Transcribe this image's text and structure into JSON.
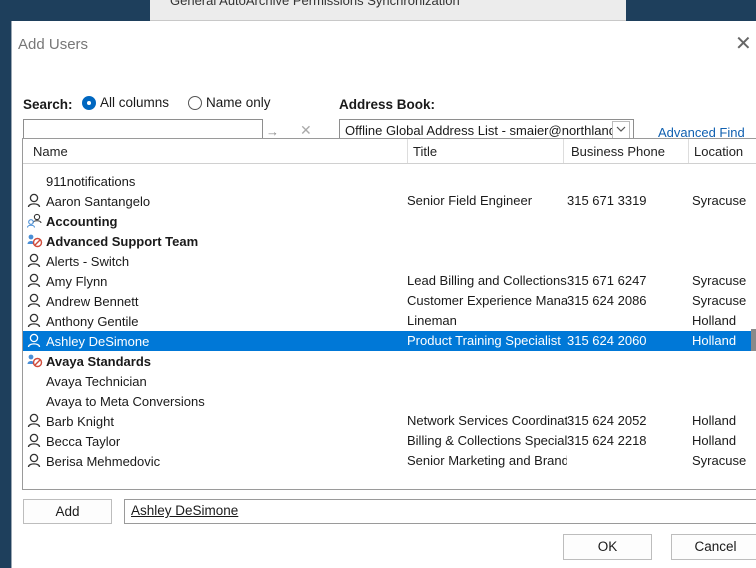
{
  "background_window": {
    "tabs_text": "General  AutoArchive  Permissions  Synchronization"
  },
  "dialog": {
    "title": "Add Users",
    "close_glyph": "✕"
  },
  "search": {
    "label": "Search:",
    "option_all": "All columns",
    "option_name": "Name only",
    "selected": "All columns",
    "input_value": "",
    "go_glyph": "→",
    "clear_glyph": "✕"
  },
  "address_book": {
    "label": "Address Book:",
    "selected": "Offline Global Address List - smaier@northland",
    "advanced_find": "Advanced Find"
  },
  "table": {
    "columns": [
      "Name",
      "Title",
      "Business Phone",
      "Location"
    ],
    "rows": [
      {
        "icon": "none",
        "name": "911notifications",
        "title": "",
        "phone": "",
        "location": "",
        "bold": false,
        "selected": false
      },
      {
        "icon": "user-icon",
        "name": "Aaron Santangelo",
        "title": "Senior Field Engineer",
        "phone": "315 671 3319",
        "location": "Syracuse",
        "bold": false,
        "selected": false
      },
      {
        "icon": "contact-group-icon",
        "name": "Accounting",
        "title": "",
        "phone": "",
        "location": "",
        "bold": true,
        "selected": false
      },
      {
        "icon": "distribution-list-icon",
        "name": "Advanced Support Team",
        "title": "",
        "phone": "",
        "location": "",
        "bold": true,
        "selected": false
      },
      {
        "icon": "user-icon",
        "name": "Alerts - Switch",
        "title": "",
        "phone": "",
        "location": "",
        "bold": false,
        "selected": false
      },
      {
        "icon": "user-icon",
        "name": "Amy Flynn",
        "title": "Lead Billing and Collections",
        "phone": "315 671 6247",
        "location": "Syracuse",
        "bold": false,
        "selected": false
      },
      {
        "icon": "user-icon",
        "name": "Andrew Bennett",
        "title": "Customer Experience Manager",
        "phone": "315 624 2086",
        "location": "Syracuse",
        "bold": false,
        "selected": false
      },
      {
        "icon": "user-icon",
        "name": "Anthony Gentile",
        "title": "Lineman",
        "phone": "",
        "location": "Holland",
        "bold": false,
        "selected": false
      },
      {
        "icon": "user-icon",
        "name": "Ashley DeSimone",
        "title": "Product Training Specialist",
        "phone": "315 624 2060",
        "location": "Holland",
        "bold": false,
        "selected": true
      },
      {
        "icon": "distribution-list-icon",
        "name": "Avaya Standards",
        "title": "",
        "phone": "",
        "location": "",
        "bold": true,
        "selected": false
      },
      {
        "icon": "none",
        "name": "Avaya Technician",
        "title": "",
        "phone": "",
        "location": "",
        "bold": false,
        "selected": false
      },
      {
        "icon": "none",
        "name": "Avaya to Meta Conversions",
        "title": "",
        "phone": "",
        "location": "",
        "bold": false,
        "selected": false
      },
      {
        "icon": "user-icon",
        "name": "Barb Knight",
        "title": "Network Services Coordinator",
        "phone": "315 624 2052",
        "location": "Holland",
        "bold": false,
        "selected": false
      },
      {
        "icon": "user-icon",
        "name": "Becca Taylor",
        "title": "Billing & Collections Specialist",
        "phone": "315 624 2218",
        "location": "Holland",
        "bold": false,
        "selected": false
      },
      {
        "icon": "user-icon",
        "name": "Berisa Mehmedovic",
        "title": "Senior Marketing and Brand",
        "phone": "",
        "location": "Syracuse",
        "bold": false,
        "selected": false
      }
    ]
  },
  "bottom": {
    "add_label": "Add",
    "add_value": "Ashley DeSimone",
    "ok_label": "OK",
    "cancel_label": "Cancel"
  },
  "colors": {
    "selection": "#0078d7",
    "link": "#1060b0",
    "radio_on": "#0067c0",
    "dl_icon_blue": "#4a8fd6",
    "dl_icon_red": "#d04a3a"
  }
}
